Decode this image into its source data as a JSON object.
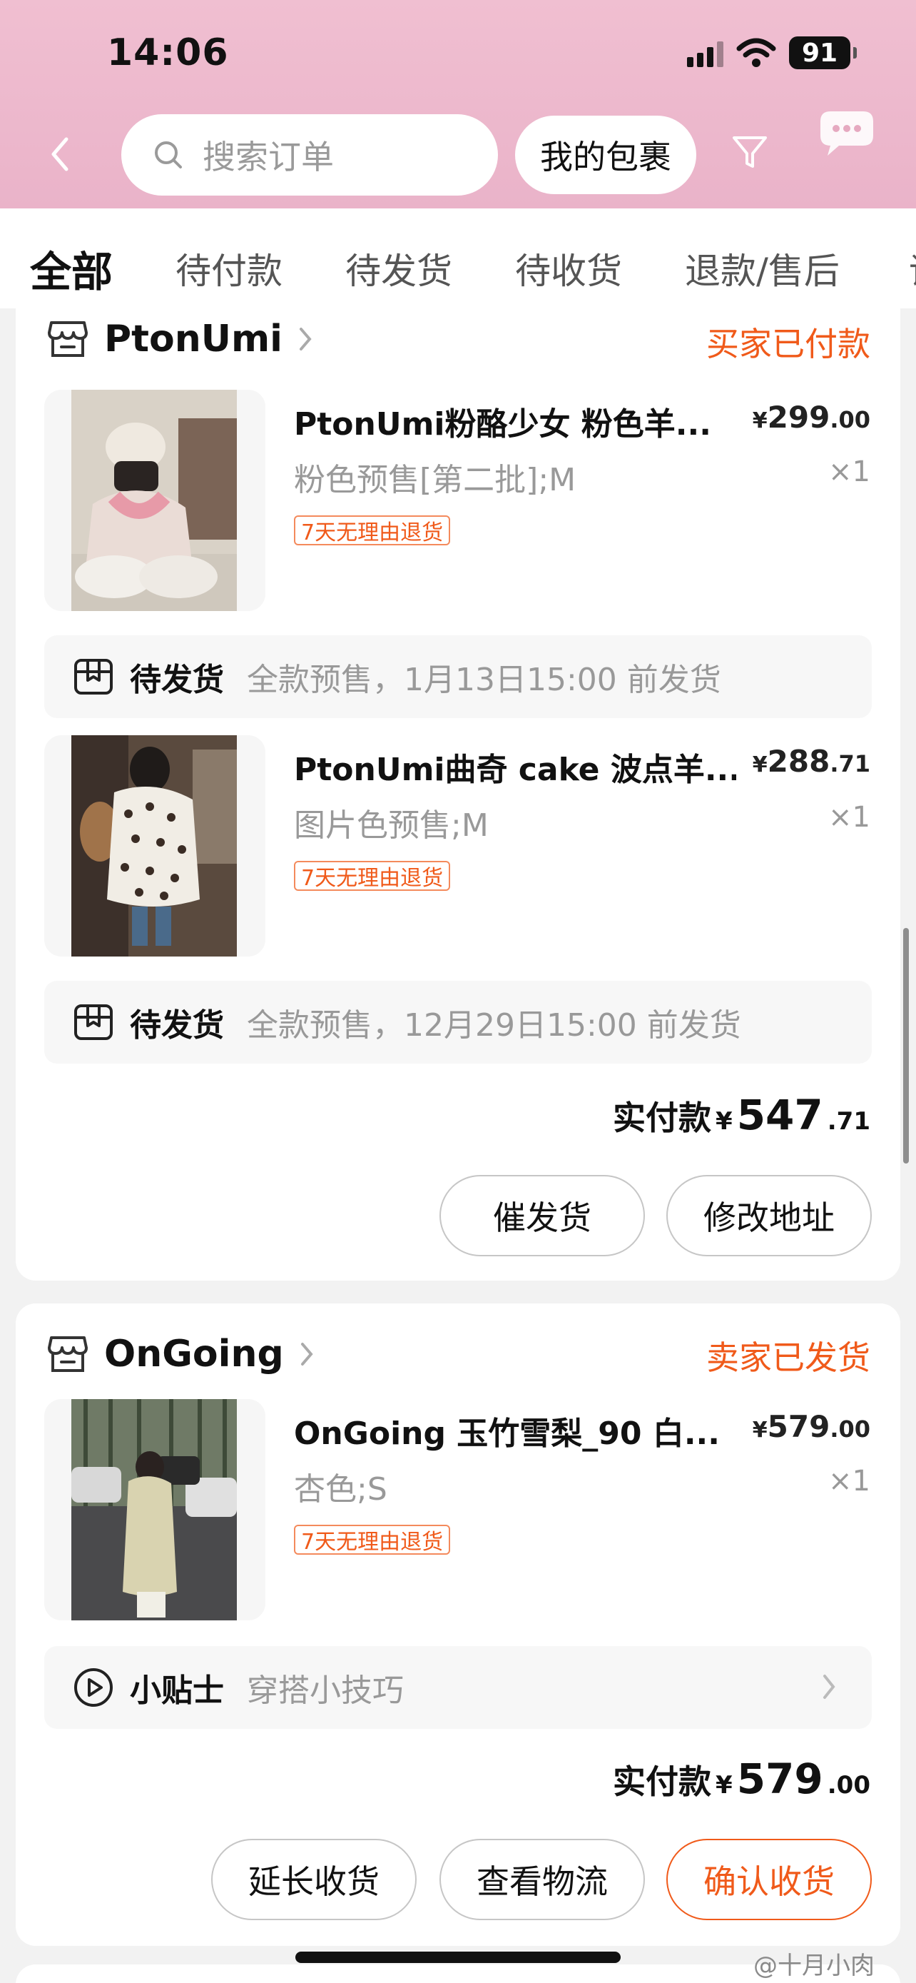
{
  "status_bar": {
    "time": "14:06",
    "battery": "91"
  },
  "header": {
    "search_placeholder": "搜索订单",
    "parcel_button": "我的包裹",
    "icons": [
      "back-icon",
      "search-icon",
      "filter-icon",
      "chat-bubble-icon"
    ]
  },
  "tabs": [
    "全部",
    "待付款",
    "待发货",
    "待收货",
    "退款/售后",
    "评价"
  ],
  "active_tab": "全部",
  "orders": [
    {
      "shop": "PtonUmi",
      "status": "买家已付款",
      "items": [
        {
          "title": "PtonUmi粉酪少女 粉色羊...",
          "price_yen": "¥",
          "price_int": "299",
          "price_dec": ".00",
          "sku": "粉色预售[第二批];M",
          "qty": "×1",
          "tag": "7天无理由退货",
          "ship_label": "待发货",
          "ship_text": "全款预售，1月13日15:00 前发货"
        },
        {
          "title": "PtonUmi曲奇 cake 波点羊...",
          "price_yen": "¥",
          "price_int": "288",
          "price_dec": ".71",
          "sku": "图片色预售;M",
          "qty": "×1",
          "tag": "7天无理由退货",
          "ship_label": "待发货",
          "ship_text": "全款预售，12月29日15:00 前发货"
        }
      ],
      "total_label": "实付款",
      "total_yen": "¥",
      "total_int": "547",
      "total_dec": ".71",
      "buttons": [
        "催发货",
        "修改地址"
      ]
    },
    {
      "shop": "OnGoing",
      "status": "卖家已发货",
      "items": [
        {
          "title": "OnGoing 玉竹雪梨_90 白...",
          "price_yen": "¥",
          "price_int": "579",
          "price_dec": ".00",
          "sku": "杏色;S",
          "qty": "×1",
          "tag": "7天无理由退货"
        }
      ],
      "tip_label": "小贴士",
      "tip_text": "穿搭小技巧",
      "total_label": "实付款",
      "total_yen": "¥",
      "total_int": "579",
      "total_dec": ".00",
      "buttons": [
        "延长收货",
        "查看物流",
        "确认收货"
      ]
    }
  ],
  "watermark": "@十月小肉",
  "colors": {
    "header_pink": "#eab3c9",
    "accent_orange": "#f05a1a"
  }
}
